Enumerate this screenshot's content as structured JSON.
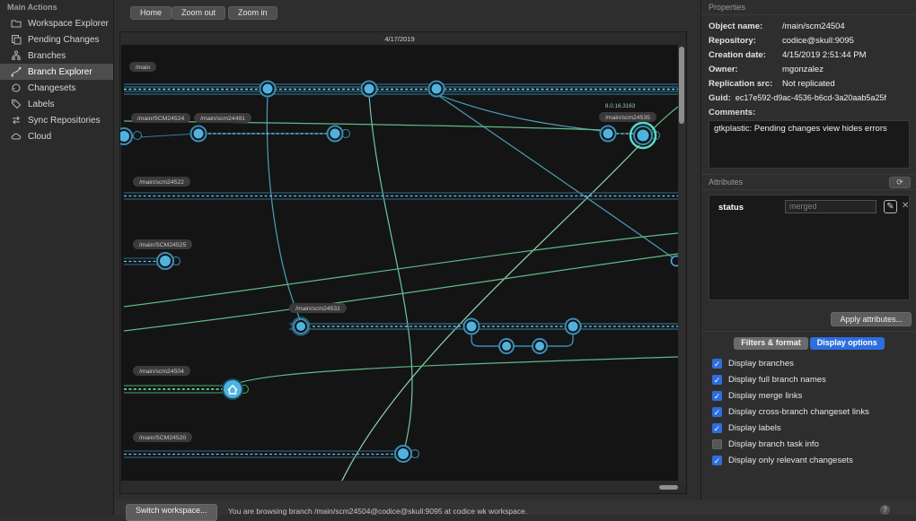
{
  "sidebar": {
    "header": "Main Actions",
    "items": [
      {
        "label": "Workspace Explorer",
        "icon": "folder-icon",
        "selected": false
      },
      {
        "label": "Pending Changes",
        "icon": "pending-changes-icon",
        "selected": false
      },
      {
        "label": "Branches",
        "icon": "branches-icon",
        "selected": false
      },
      {
        "label": "Branch Explorer",
        "icon": "branch-explorer-icon",
        "selected": true
      },
      {
        "label": "Changesets",
        "icon": "changesets-icon",
        "selected": false
      },
      {
        "label": "Labels",
        "icon": "tag-icon",
        "selected": false
      },
      {
        "label": "Sync Repositories",
        "icon": "sync-icon",
        "selected": false
      },
      {
        "label": "Cloud",
        "icon": "cloud-icon",
        "selected": false
      }
    ]
  },
  "toolbar": {
    "home": "Home",
    "zoom_out": "Zoom out",
    "zoom_in": "Zoom in"
  },
  "canvas": {
    "date_header": "4/17/2019",
    "version_label": "8.0.16.3163",
    "branch_labels": [
      "/main",
      "/main/SCM24524",
      "/main/scm24491",
      "/main/scm24535",
      "/main/scm24522",
      "/main/SCM24525",
      "/main/scm24531",
      "/main/scm24504",
      "/main/SCM24520"
    ],
    "colors": {
      "branch_blue": "#2f7ea6",
      "dash_blue": "#7fd4f2",
      "node_fill": "#4fb3e0",
      "merge_green": "#5fba85",
      "pale_green": "#8fd9b0",
      "selected_ring": "#56dcc3",
      "background": "#141414"
    }
  },
  "properties": {
    "title": "Properties",
    "rows": [
      {
        "label": "Object name:",
        "value": "/main/scm24504"
      },
      {
        "label": "Repository:",
        "value": "codice@skull:9095"
      },
      {
        "label": "Creation date:",
        "value": "4/15/2019 2:51:44 PM"
      },
      {
        "label": "Owner:",
        "value": "mgonzalez"
      },
      {
        "label": "Replication src:",
        "value": "Not replicated"
      }
    ],
    "guid": {
      "label": "Guid:",
      "value": "ec17e592-d9ac-4536-b6cd-3a20aab5a25f"
    },
    "comments_label": "Comments:",
    "comments_text": "gtkplastic: Pending changes view hides errors"
  },
  "attributes": {
    "title": "Attributes",
    "refresh_icon": "refresh-icon",
    "name": "status",
    "value_placeholder": "merged",
    "apply_label": "Apply attributes..."
  },
  "options": {
    "tabs": [
      {
        "label": "Filters & format",
        "active": false
      },
      {
        "label": "Display options",
        "active": true
      }
    ],
    "checkboxes": [
      {
        "label": "Display branches",
        "checked": true
      },
      {
        "label": "Display full branch names",
        "checked": true
      },
      {
        "label": "Display merge links",
        "checked": true
      },
      {
        "label": "Display cross-branch changeset links",
        "checked": true
      },
      {
        "label": "Display labels",
        "checked": true
      },
      {
        "label": "Display branch task info",
        "checked": false
      },
      {
        "label": "Display only relevant changesets",
        "checked": true
      }
    ],
    "check_glyph": "✓"
  },
  "footer": {
    "switch_label": "Switch workspace...",
    "status_text": "You are browsing branch /main/scm24504@codice@skull:9095 at codice wk workspace.",
    "help_label": "?"
  }
}
